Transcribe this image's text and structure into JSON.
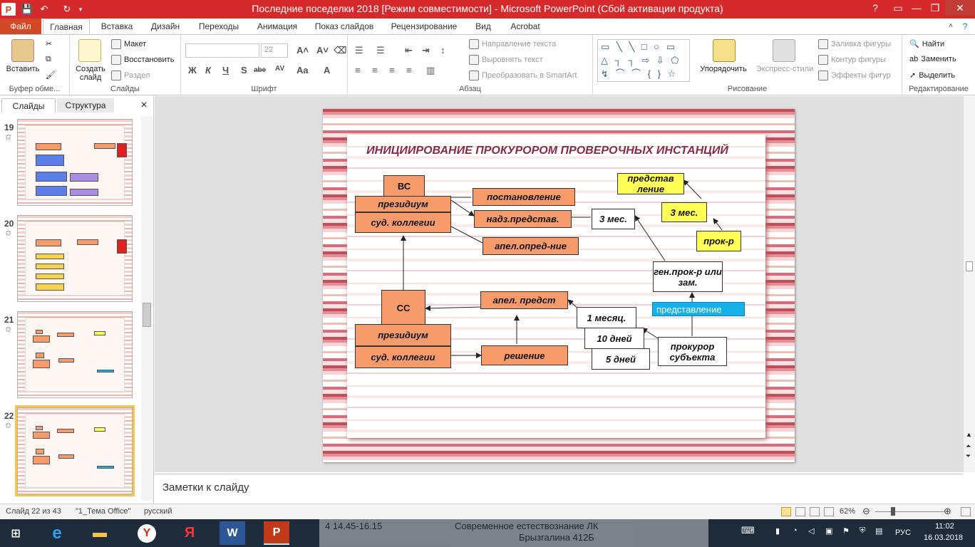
{
  "window": {
    "title": "Последние поседелки 2018 [Режим совместимости] - Microsoft PowerPoint (Сбой активации продукта)",
    "controls": [
      "?",
      "▭",
      "—",
      "❐",
      "✕"
    ]
  },
  "tabs": [
    "Файл",
    "Главная",
    "Вставка",
    "Дизайн",
    "Переходы",
    "Анимация",
    "Показ слайдов",
    "Рецензирование",
    "Вид",
    "Acrobat"
  ],
  "ribbon": {
    "clipboard": {
      "paste": "Вставить",
      "group": "Буфер обме..."
    },
    "slides": {
      "new_slide": "Создать слайд",
      "layout": "Макет",
      "reset": "Восстановить",
      "section": "Раздел",
      "group": "Слайды"
    },
    "font": {
      "font_size": "22",
      "group": "Шрифт",
      "bold": "Ж",
      "italic": "К",
      "underline": "Ч",
      "shadow": "S",
      "strike": "abe",
      "spacing": "AV",
      "case": "Aa",
      "color": "A"
    },
    "paragraph": {
      "text_direction": "Направление текста",
      "align_text": "Выровнять текст",
      "smartart": "Преобразовать в SmartArt",
      "group": "Абзац"
    },
    "drawing": {
      "arrange": "Упорядочить",
      "quick_styles": "Экспресс-стили",
      "fill": "Заливка фигуры",
      "outline": "Контур фигуры",
      "effects": "Эффекты фигур",
      "group": "Рисование",
      "shapes_row1": "▭ ╲ ╲ □ ○ ▭",
      "shapes_row2": "△ ┐ ┐ ⇨ ⇩ ⬠",
      "shapes_row3": "↯ ⌒ ⌒ { } ☆"
    },
    "editing": {
      "find": "Найти",
      "replace": "Заменить",
      "select": "Выделить",
      "group": "Редактирование"
    }
  },
  "left_pane": {
    "tab_slides": "Слайды",
    "tab_outline": "Структура",
    "close": "×",
    "thumbnails": [
      {
        "num": "19"
      },
      {
        "num": "20"
      },
      {
        "num": "21"
      },
      {
        "num": "22"
      }
    ]
  },
  "slide": {
    "title": "ИНИЦИИРОВАНИЕ    ПРОКУРОРОМ  ПРОВЕРОЧНЫХ ИНСТАНЦИЙ",
    "boxes": {
      "vs": "ВС",
      "presidium_top": "президиум",
      "sud_top": "суд. коллегии",
      "postanovlenie": "постановление",
      "nadz": "надз.представ.",
      "apel_opred": "апел.опред-ние",
      "months3_white": "3 мес.",
      "predstavlenie_y": "представ ление",
      "months3_yellow": "3 мес.",
      "prok_r": "прок-р",
      "gen_prok": "ген.прок-р или зам.",
      "predstavlenie_b": "представление",
      "ss": "СС",
      "apel_predst": "апел. предст",
      "month1": "1 месяц.",
      "days10": "10 дней",
      "days5": "5 дней",
      "prokuror_subj": "прокурор субъекта",
      "presidium_bot": "президиум",
      "sud_bot": "суд. коллегии",
      "reshenie": "решение"
    }
  },
  "notes": {
    "placeholder": "Заметки к слайду"
  },
  "status": {
    "slide_info": "Слайд 22 из 43",
    "theme": "\"1_Тема Office\"",
    "language": "русский",
    "zoom": "62%"
  },
  "taskbar": {
    "lang": "РУС",
    "time": "11:02",
    "date": "16.03.2018"
  },
  "background_doc": {
    "line1": "4   14.45-16.15",
    "line2": "Современное естествознание ЛК",
    "line3": "Брызгалина 412Б"
  }
}
